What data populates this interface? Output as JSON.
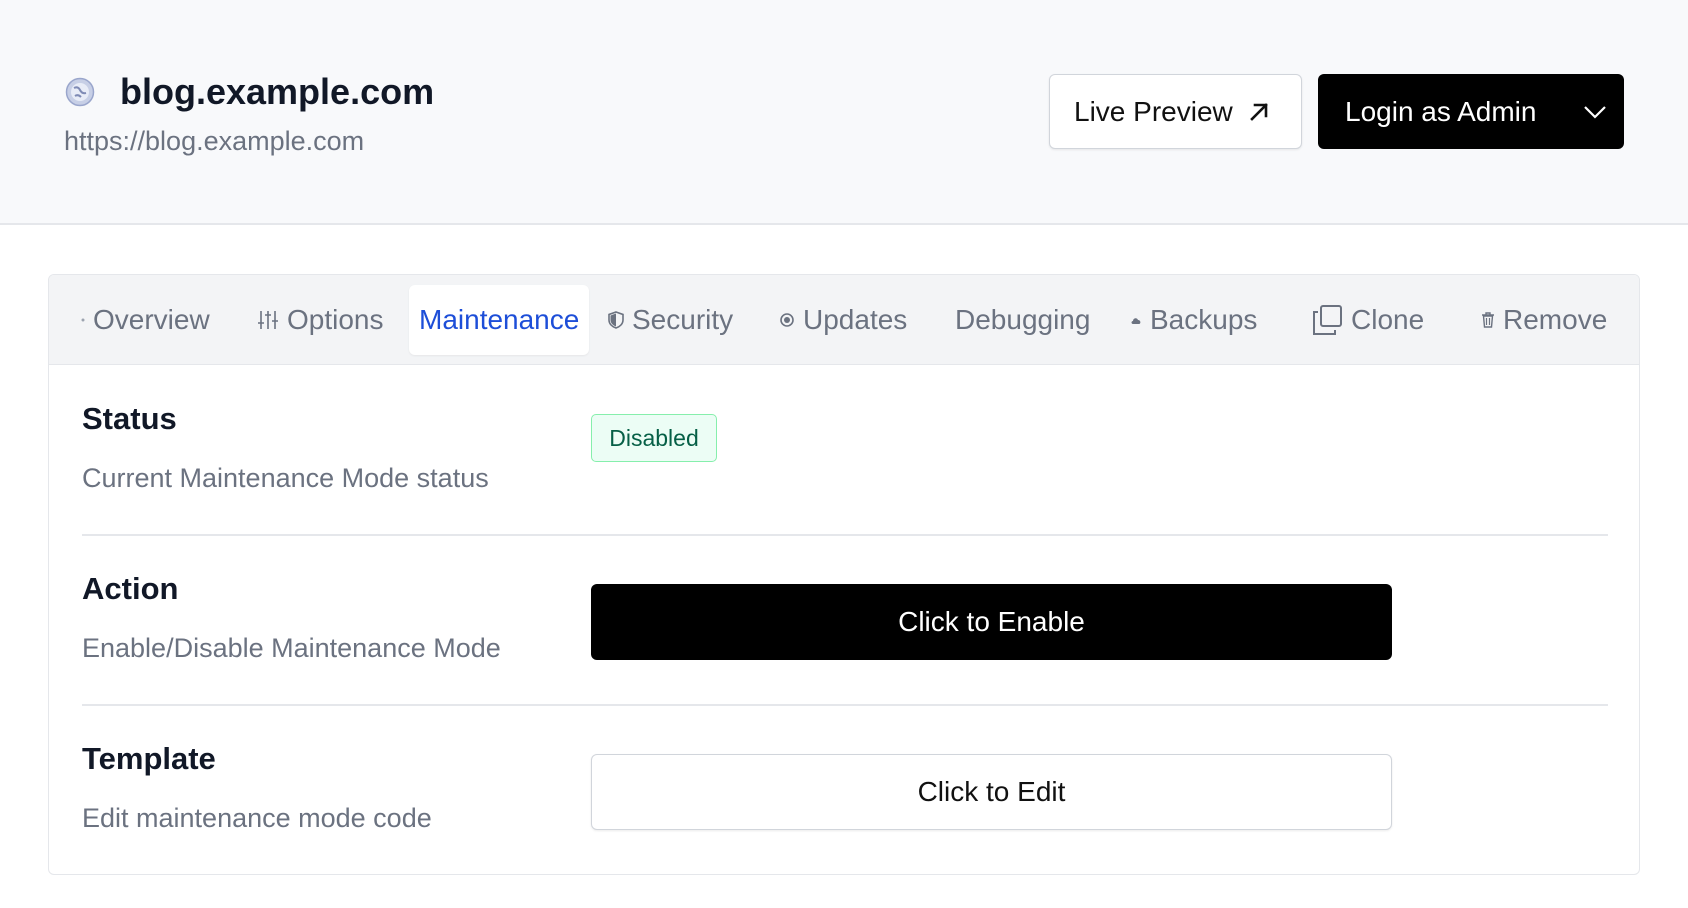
{
  "header": {
    "site_name": "blog.example.com",
    "site_url": "https://blog.example.com",
    "site_icon": "globe-icon",
    "live_preview_label": "Live Preview",
    "live_preview_icon": "external-link-arrow-icon",
    "login_label": "Login as Admin",
    "login_dropdown_icon": "chevron-down-icon"
  },
  "tabs": [
    {
      "label": "Overview",
      "icon": "dot-icon",
      "active": false
    },
    {
      "label": "Options",
      "icon": "sliders-icon",
      "active": false
    },
    {
      "label": "Maintenance",
      "icon": "",
      "active": true
    },
    {
      "label": "Security",
      "icon": "shield-icon",
      "active": false
    },
    {
      "label": "Updates",
      "icon": "refresh-icon",
      "active": false
    },
    {
      "label": "Debugging",
      "icon": "",
      "active": false
    },
    {
      "label": "Backups",
      "icon": "cloud-icon",
      "active": false
    },
    {
      "label": "Clone",
      "icon": "copy-icon",
      "active": false
    },
    {
      "label": "Remove",
      "icon": "trash-icon",
      "active": false
    }
  ],
  "maintenance": {
    "status": {
      "title": "Status",
      "description": "Current Maintenance Mode status",
      "badge": "Disabled"
    },
    "action": {
      "title": "Action",
      "description": "Enable/Disable Maintenance Mode",
      "button": "Click to Enable"
    },
    "template": {
      "title": "Template",
      "description": "Edit maintenance mode code",
      "button": "Click to Edit"
    }
  },
  "colors": {
    "accent": "#1d4ed8",
    "primary_button": "#000000",
    "badge_bg": "#ecfdf5",
    "badge_border": "#86efac",
    "badge_text": "#065f46"
  }
}
